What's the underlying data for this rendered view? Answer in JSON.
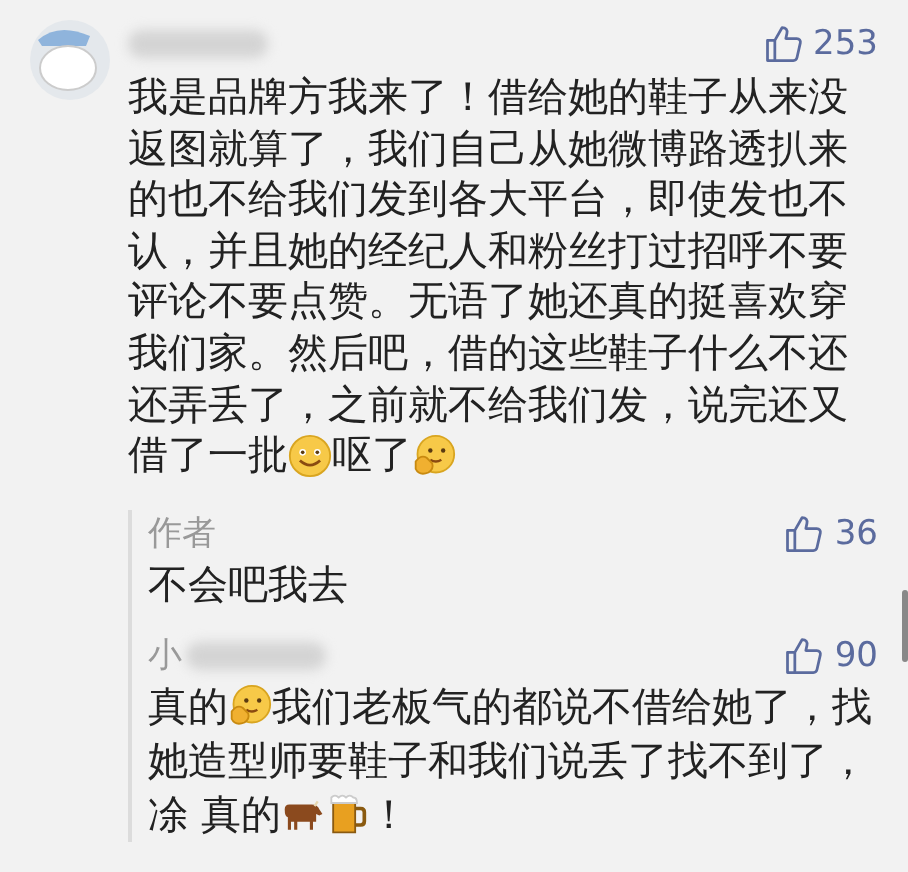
{
  "comment": {
    "likes": "253",
    "lines": [
      [
        {
          "kind": "text",
          "text": "我是品牌方我来了！借给她的鞋子从来没"
        }
      ],
      [
        {
          "kind": "text",
          "text": "返图就算了，我们自己从她微博路透扒来"
        }
      ],
      [
        {
          "kind": "text",
          "text": "的也不给我们发到各大平台，即使发也不"
        }
      ],
      [
        {
          "kind": "text",
          "text": "认，并且她的经纪人和粉丝打过招呼不要"
        }
      ],
      [
        {
          "kind": "text",
          "text": "评论不要点赞。无语了她还真的挺喜欢穿"
        }
      ],
      [
        {
          "kind": "text",
          "text": "我们家。然后吧，借的这些鞋子什么不还"
        }
      ],
      [
        {
          "kind": "text",
          "text": "还弄丢了，之前就不给我们发，说完还又"
        }
      ],
      [
        {
          "kind": "text",
          "text": "借了一批"
        },
        {
          "kind": "smile"
        },
        {
          "kind": "text",
          "text": "呕了"
        },
        {
          "kind": "think"
        }
      ]
    ],
    "replies": [
      {
        "name": "作者",
        "redacted": false,
        "likes": "36",
        "lines": [
          [
            {
              "kind": "text",
              "text": "不会吧我去"
            }
          ]
        ]
      },
      {
        "name": "小",
        "redacted": true,
        "likes": "90",
        "lines": [
          [
            {
              "kind": "text",
              "text": "真的"
            },
            {
              "kind": "think"
            },
            {
              "kind": "text",
              "text": "我们老板气的都说不借给她了，找"
            }
          ],
          [
            {
              "kind": "text",
              "text": "她造型师要鞋子和我们说丢了找不到了，"
            }
          ],
          [
            {
              "kind": "text",
              "text": "凃 真的"
            },
            {
              "kind": "cow"
            },
            {
              "kind": "beer"
            },
            {
              "kind": "text",
              "text": "！"
            }
          ]
        ]
      }
    ]
  }
}
